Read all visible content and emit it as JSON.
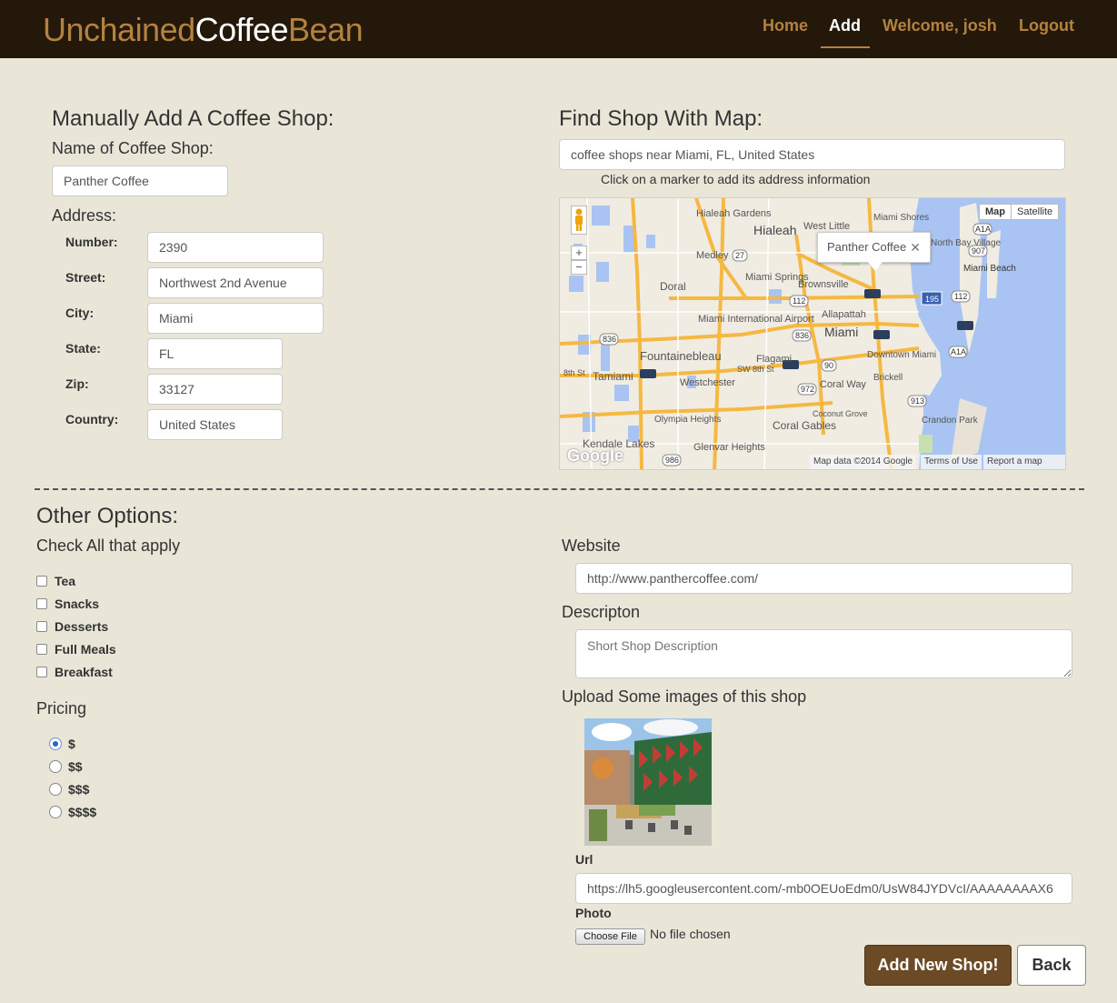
{
  "navbar": {
    "brand": {
      "part1": "Unchained",
      "part2": "Coffee",
      "part3": "Bean"
    },
    "items": [
      "Home",
      "Add",
      "Welcome, josh",
      "Logout"
    ],
    "active": "Add"
  },
  "manual": {
    "heading": "Manually Add A Coffee Shop:",
    "name_label": "Name of Coffee Shop:",
    "name_value": "Panther Coffee",
    "address_label": "Address:",
    "fields": {
      "number": {
        "label": "Number:",
        "value": "2390"
      },
      "street": {
        "label": "Street:",
        "value": "Northwest 2nd Avenue"
      },
      "city": {
        "label": "City:",
        "value": "Miami"
      },
      "state": {
        "label": "State:",
        "value": "FL"
      },
      "zip": {
        "label": "Zip:",
        "value": "33127"
      },
      "country": {
        "label": "Country:",
        "value": "United States"
      }
    }
  },
  "mapsearch": {
    "heading": "Find Shop With Map:",
    "query": "coffee shops near Miami, FL, United States",
    "hint": "Click on a marker to add its address information",
    "map_toggle": [
      "Map",
      "Satellite"
    ],
    "info_window": "Panther Coffee",
    "zoom": [
      "+",
      "−"
    ],
    "labels": [
      "Hialeah Gardens",
      "Hialeah",
      "West Little",
      "Miami Shores",
      "Medley",
      "Miami Springs",
      "Brownsville",
      "Doral",
      "Miami International Airport",
      "Allapattah",
      "Miami",
      "Fountainebleau",
      "Flagami",
      "Downtown Miami",
      "Brickell",
      "Tamiami",
      "Westchester",
      "Coral Way",
      "Olympia Heights",
      "Coral Gables",
      "Coconut Grove",
      "Kendale Lakes",
      "Glenvar Heights",
      "Crandon Park",
      "Miami Beach",
      "North Bay Village",
      "8th St",
      "SW 8th St"
    ],
    "road_shields": [
      "27",
      "112",
      "836",
      "836",
      "90",
      "972",
      "986",
      "913",
      "907",
      "A1A",
      "A1A",
      "112",
      "195"
    ],
    "footer": {
      "data": "Map data ©2014 Google",
      "terms": "Terms of Use",
      "report": "Report a map error"
    },
    "logo": "Google"
  },
  "options": {
    "heading": "Other Options:",
    "check_label": "Check All that apply",
    "checkboxes": [
      "Tea",
      "Snacks",
      "Desserts",
      "Full Meals",
      "Breakfast"
    ],
    "pricing_label": "Pricing",
    "pricing": [
      "$",
      "$$",
      "$$$",
      "$$$$"
    ],
    "pricing_selected": "$"
  },
  "details": {
    "website_label": "Website",
    "website_value": "http://www.panthercoffee.com/",
    "desc_label": "Descripton",
    "desc_placeholder": "Short Shop Description",
    "upload_label": "Upload Some images of this shop",
    "url_label": "Url",
    "url_value": "https://lh5.googleusercontent.com/-mb0OEUoEdm0/UsW84JYDVcI/AAAAAAAAX6",
    "photo_label": "Photo",
    "file_button": "Choose File",
    "file_status": "No file chosen"
  },
  "actions": {
    "submit": "Add New Shop!",
    "back": "Back"
  },
  "colors": {
    "nav_bg": "#24180b",
    "accent": "#b3823f",
    "page_bg": "#e9e6d8",
    "primary_btn": "#6b4a25"
  }
}
